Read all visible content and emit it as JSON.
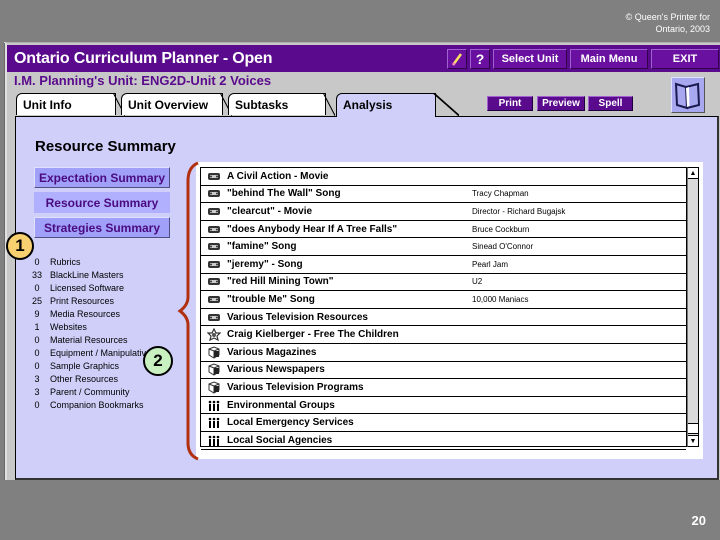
{
  "copyright": {
    "line1": "© Queen's Printer for",
    "line2": "Ontario, 2003"
  },
  "slide_number": "20",
  "window": {
    "title": "Ontario Curriculum Planner - Open",
    "toolbar": {
      "edit_icon": "pencil-icon",
      "help_label": "?",
      "select_unit_label": "Select Unit",
      "main_menu_label": "Main Menu",
      "exit_label": "EXIT"
    },
    "unit_line": "I.M. Planning's Unit:  ENG2D-Unit 2  Voices",
    "tabs": [
      {
        "label": "Unit Info",
        "active": false
      },
      {
        "label": "Unit Overview",
        "active": false
      },
      {
        "label": "Subtasks",
        "active": false
      },
      {
        "label": "Analysis",
        "active": true
      }
    ],
    "actions": {
      "print_label": "Print",
      "preview_label": "Preview",
      "spell_label": "Spell",
      "book_icon": "book-icon"
    }
  },
  "panel": {
    "title": "Resource Summary",
    "summary_buttons": [
      {
        "label": "Expectation Summary",
        "active": false
      },
      {
        "label": "Resource Summary",
        "active": true
      },
      {
        "label": "Strategies Summary",
        "active": false
      }
    ],
    "counts": [
      {
        "count": "0",
        "label": "Rubrics"
      },
      {
        "count": "33",
        "label": "BlackLine Masters"
      },
      {
        "count": "0",
        "label": "Licensed Software"
      },
      {
        "count": "25",
        "label": "Print Resources"
      },
      {
        "count": "9",
        "label": "Media Resources"
      },
      {
        "count": "1",
        "label": "Websites"
      },
      {
        "count": "0",
        "label": "Material Resources"
      },
      {
        "count": "0",
        "label": "Equipment / Manipulatives"
      },
      {
        "count": "0",
        "label": "Sample Graphics"
      },
      {
        "count": "3",
        "label": "Other Resources"
      },
      {
        "count": "3",
        "label": "Parent / Community"
      },
      {
        "count": "0",
        "label": "Companion Bookmarks"
      }
    ],
    "resources": [
      {
        "icon": "media-icon",
        "title": "A Civil Action - Movie",
        "author": ""
      },
      {
        "icon": "media-icon",
        "title": "\"behind The Wall\"   Song",
        "author": "Tracy Chapman"
      },
      {
        "icon": "media-icon",
        "title": "\"clearcut\" - Movie",
        "author": "Director - Richard Bugajsk"
      },
      {
        "icon": "media-icon",
        "title": "\"does Anybody Hear If A Tree Falls\"",
        "author": "Bruce Cockburn"
      },
      {
        "icon": "media-icon",
        "title": "\"famine\"   Song",
        "author": "Sinead O'Connor"
      },
      {
        "icon": "media-icon",
        "title": "\"jeremy\" - Song",
        "author": "Pearl Jam"
      },
      {
        "icon": "media-icon",
        "title": "\"red Hill Mining Town\"",
        "author": "U2"
      },
      {
        "icon": "media-icon",
        "title": "\"trouble Me\"   Song",
        "author": "10,000 Maniacs"
      },
      {
        "icon": "media-icon",
        "title": "Various Television Resources",
        "author": ""
      },
      {
        "icon": "website-icon",
        "title": "Craig Kielberger - Free The Children",
        "author": ""
      },
      {
        "icon": "other-resource-icon",
        "title": "Various Magazines",
        "author": ""
      },
      {
        "icon": "other-resource-icon",
        "title": "Various Newspapers",
        "author": ""
      },
      {
        "icon": "other-resource-icon",
        "title": "Various Television Programs",
        "author": ""
      },
      {
        "icon": "community-icon",
        "title": "Environmental Groups",
        "author": ""
      },
      {
        "icon": "community-icon",
        "title": "Local Emergency Services",
        "author": ""
      },
      {
        "icon": "community-icon",
        "title": "Local Social Agencies",
        "author": ""
      }
    ]
  },
  "callouts": [
    {
      "label": "1",
      "color": "#f8d070"
    },
    {
      "label": "2",
      "color": "#c8f0c0"
    }
  ],
  "colors": {
    "titlebar": "#5a0a8c",
    "panel": "#cfcffa",
    "bracket": "#b03010"
  }
}
